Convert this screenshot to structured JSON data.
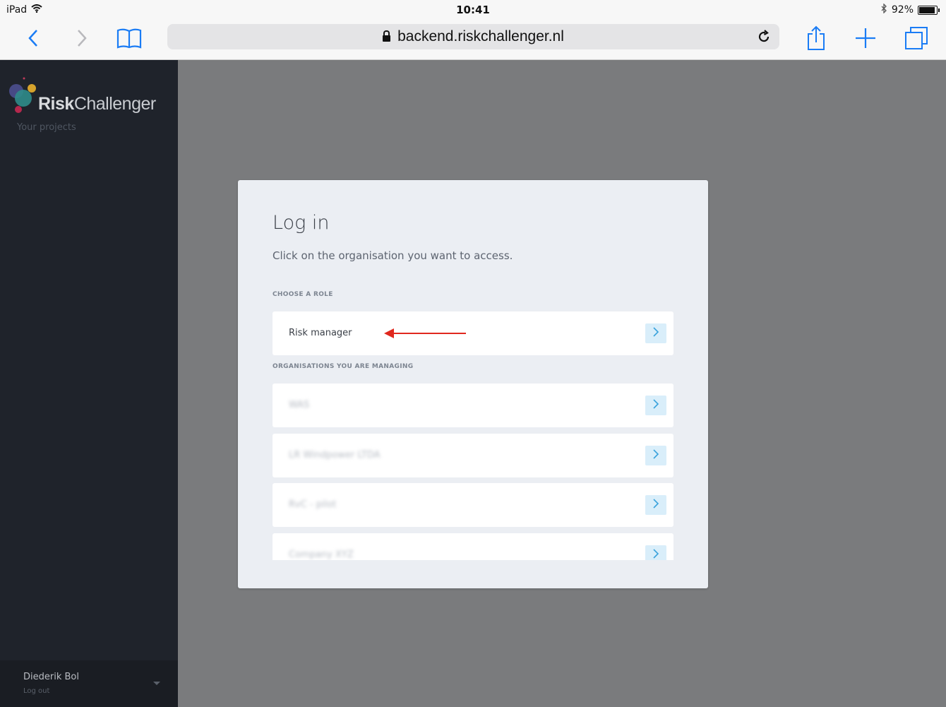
{
  "statusbar": {
    "device": "iPad",
    "time": "10:41",
    "battery": "92%"
  },
  "browser": {
    "url": "backend.riskchallenger.nl"
  },
  "sidebar": {
    "brand_bold": "Risk",
    "brand_light": "Challenger",
    "your_projects": "Your projects",
    "user_name": "Diederik Bol",
    "logout": "Log out"
  },
  "login": {
    "title": "Log in",
    "subtitle": "Click on the organisation you want to access.",
    "choose_role_label": "CHOOSE A ROLE",
    "role": "Risk manager",
    "orgs_label": "ORGANISATIONS YOU ARE MANAGING",
    "organisations": [
      "WAS",
      "LR Windpower LTDA",
      "RvC - pilot",
      "Company XYZ"
    ]
  },
  "colors": {
    "sidebar_bg": "#1f232b",
    "card_bg": "#ebeef3",
    "accent_blue": "#3aa3dc",
    "annotation_red": "#e0281e"
  },
  "icons": [
    "back-icon",
    "forward-icon",
    "bookmarks-icon",
    "lock-icon",
    "reload-icon",
    "share-icon",
    "new-tab-icon",
    "tabs-icon",
    "wifi-icon",
    "bluetooth-icon",
    "battery-icon",
    "chevron-right-icon",
    "chevron-down-icon"
  ]
}
